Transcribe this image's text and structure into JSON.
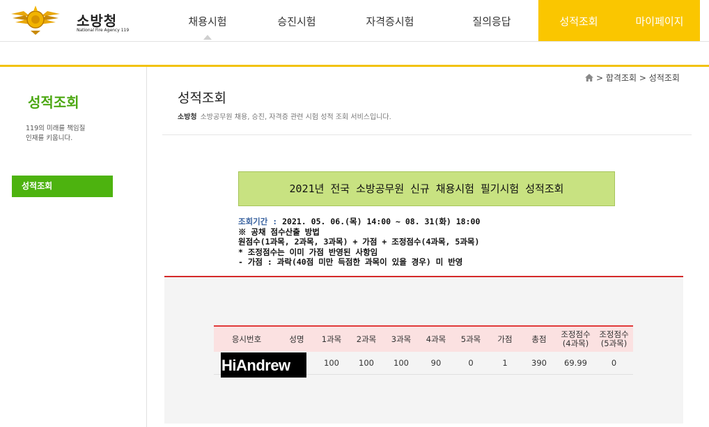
{
  "header": {
    "logo_text": "소방청",
    "logo_sub": "National Fire Agency 119",
    "nav": [
      "채용시험",
      "승진시험",
      "자격증시험",
      "질의응답",
      "성적조회",
      "마이페이지"
    ]
  },
  "sidebar": {
    "title": "성적조회",
    "desc_line1": "119의 미래를 책임질",
    "desc_line2": "인재를 키웁니다.",
    "menu_item": "성적조회"
  },
  "breadcrumb": {
    "item1": "합격조회",
    "item2": "성적조회",
    "separator": ">"
  },
  "page": {
    "title": "성적조회",
    "desc_org": "소방청",
    "desc_text": "소방공무원 채용, 승진, 자격증 관련 시험 성적 조회 서비스입니다."
  },
  "exam": {
    "banner": "2021년 전국 소방공무원 신규 채용시험 필기시험 성적조회",
    "period_label": "조회기간 :",
    "period_value": "2021. 05. 06.(목) 14:00 ~ 08. 31(화) 18:00",
    "line2": "※ 공채 점수산출 방법",
    "line3": "원점수(1과목, 2과목, 3과목) + 가점 + 조정점수(4과목, 5과목)",
    "line4": "* 조정점수는 이미 가점 반영된 사항임",
    "line5": "- 가점 : 과락(40점 미만 득점한 과목이 있을 경우) 미 반영"
  },
  "table": {
    "headers": [
      "응시번호",
      "성명",
      "1과목",
      "2과목",
      "3과목",
      "4과목",
      "5과목",
      "가점",
      "총점",
      "조정점수\n(4과목)",
      "조정점수\n(5과목)"
    ],
    "row": [
      "",
      "",
      "100",
      "100",
      "100",
      "90",
      "0",
      "1",
      "390",
      "69.99",
      "0"
    ]
  },
  "mask_text": "HiAndrew",
  "colors": {
    "brand_yellow": "#fac600",
    "green": "#4db30f",
    "banner_green": "#c8e281",
    "red": "#d52a2a"
  }
}
